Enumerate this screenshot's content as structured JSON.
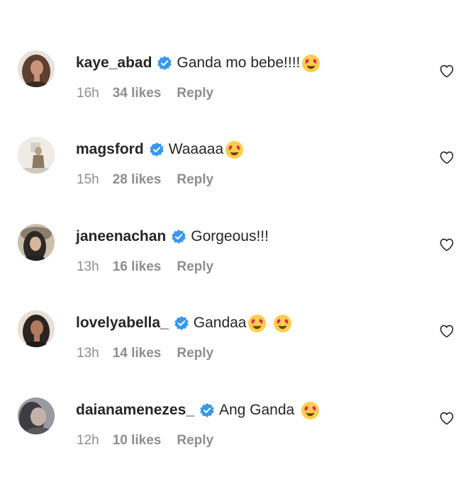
{
  "comments": [
    {
      "username": "kaye_abad",
      "text": "Ganda mo bebe!!!!",
      "time": "16h",
      "likes": "34 likes",
      "reply": "Reply",
      "emojis": [
        "heart-eyes-emoji"
      ],
      "avatar_colors": [
        "#6b4a3a",
        "#c9957a"
      ]
    },
    {
      "username": "magsford",
      "text": "Waaaaa",
      "time": "15h",
      "likes": "28 likes",
      "reply": "Reply",
      "emojis": [
        "heart-eyes-emoji"
      ],
      "avatar_colors": [
        "#e9e6e1",
        "#9a8a74"
      ]
    },
    {
      "username": "janeenachan",
      "text": "Gorgeous!!!",
      "time": "13h",
      "likes": "16 likes",
      "reply": "Reply",
      "emojis": [],
      "avatar_colors": [
        "#3a3530",
        "#b8a892"
      ]
    },
    {
      "username": "lovelyabella_",
      "text": "Gandaa",
      "time": "13h",
      "likes": "14 likes",
      "reply": "Reply",
      "emojis": [
        "heart-eyes-emoji",
        "heart-eyes-emoji"
      ],
      "avatar_colors": [
        "#2a2420",
        "#b07a5e"
      ]
    },
    {
      "username": "daianamenezes_",
      "text": "Ang Ganda",
      "time": "12h",
      "likes": "10 likes",
      "reply": "Reply",
      "emojis": [
        "heart-eyes-emoji"
      ],
      "avatar_colors": [
        "#4a4a50",
        "#c4b2a8"
      ]
    }
  ],
  "icons": {
    "verified": "verified-badge-icon",
    "like": "heart-outline-icon"
  },
  "colors": {
    "text": "#262626",
    "muted": "#8e8e8e",
    "verified": "#3897f0",
    "emoji_face": "#ffcc4d",
    "emoji_heart": "#e0245e"
  }
}
